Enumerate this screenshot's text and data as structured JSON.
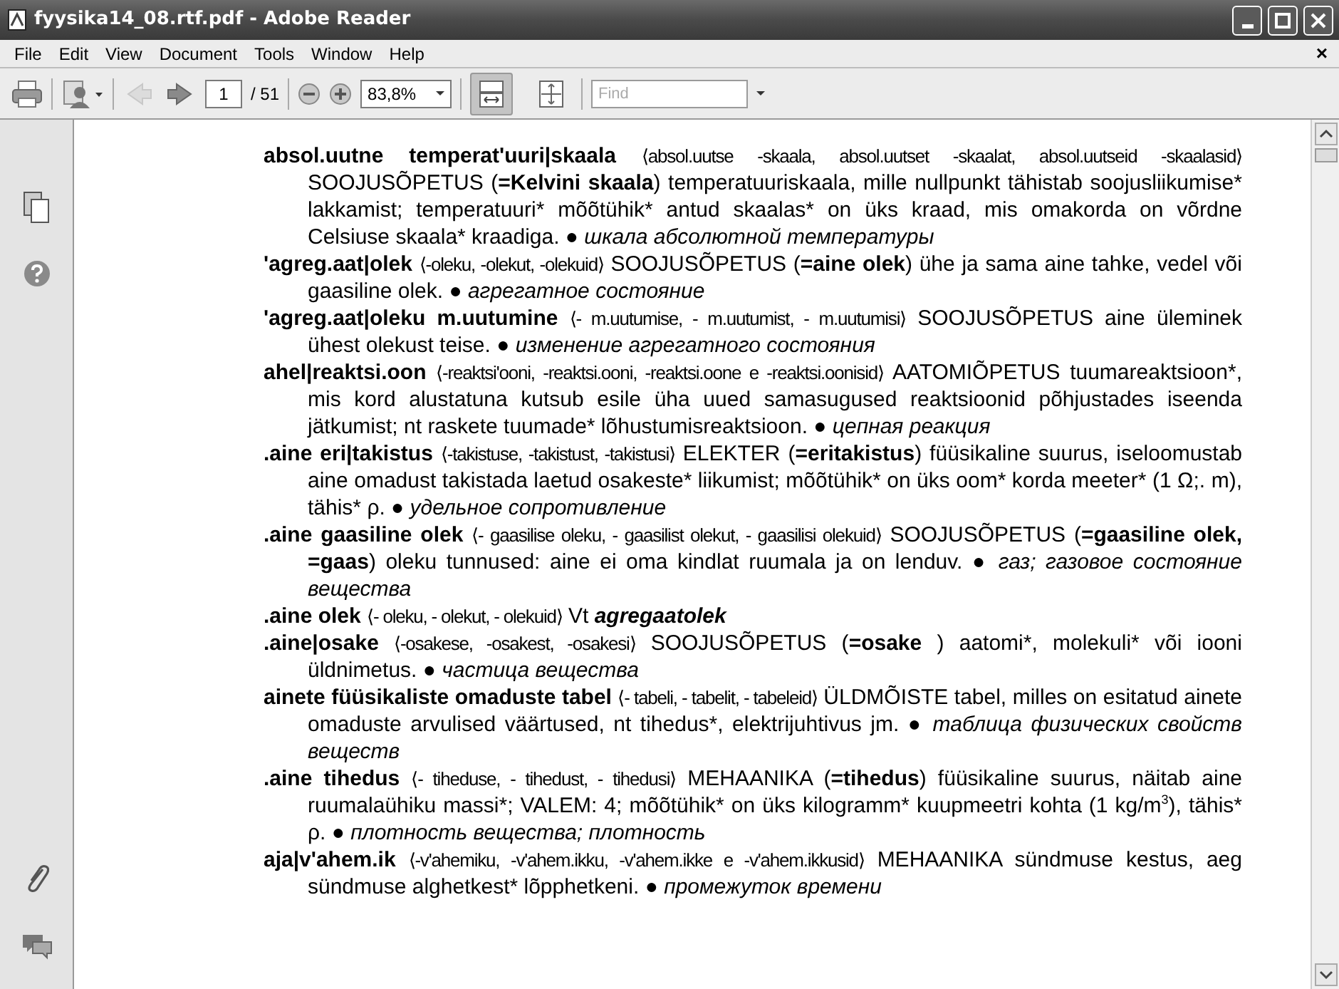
{
  "window": {
    "title": "fyysika14_08.rtf.pdf - Adobe Reader"
  },
  "menu": [
    "File",
    "Edit",
    "View",
    "Document",
    "Tools",
    "Window",
    "Help"
  ],
  "menu_close": "×",
  "toolbar": {
    "nav_buttons": [
      {
        "kind": "back",
        "disabled": true
      },
      {
        "kind": "forward",
        "disabled": false
      }
    ],
    "page_field": {
      "value": "1"
    },
    "page_count": "/ 51",
    "zoom_field": {
      "value": "83,8%"
    },
    "view_buttons": [
      {
        "kind": "fit-width",
        "selected": true
      },
      {
        "kind": "fit-page",
        "selected": false
      }
    ],
    "find_field": {
      "placeholder": "Find"
    }
  },
  "entries": [
    {
      "headword": "absol.uutne temperat'uuri|skaala",
      "forms": "⟨absol.uutse -skaala, absol.uutset -skaalat, absol.uutseid -skaalasid⟩",
      "body": [
        {
          "kind": "plain",
          "text": "SOOJUSÕPETUS ("
        },
        {
          "kind": "bold",
          "text": "=Kelvini skaala"
        },
        {
          "kind": "plain",
          "text": ") temperatuuriskaala, mille nullpunkt tähistab soojusliikumise* lakkamist; temperatuuri* mõõtühik* antud skaalas* on üks kraad, mis omakorda on võrdne Celsiuse skaala* kraadiga. ● "
        },
        {
          "kind": "italic",
          "text": "шкала абсолютной температуры"
        }
      ]
    },
    {
      "headword": "'agreg.aat|olek",
      "forms": "⟨-oleku, -olekut, -olekuid⟩",
      "body": [
        {
          "kind": "plain",
          "text": "SOOJUSÕPETUS ("
        },
        {
          "kind": "bold",
          "text": "=aine olek"
        },
        {
          "kind": "plain",
          "text": ") ühe ja sama aine tahke, vedel või gaasiline olek. ● "
        },
        {
          "kind": "italic",
          "text": "агрегатное состояние"
        }
      ]
    },
    {
      "headword": "'agreg.aat|oleku m.uutumine",
      "forms": "⟨- m.uutumise, - m.uutumist, - m.uutumisi⟩",
      "body": [
        {
          "kind": "plain",
          "text": "SOOJUSÕPETUS aine üleminek ühest olekust teise. ● "
        },
        {
          "kind": "italic",
          "text": "изменение агрегатного состояния"
        }
      ]
    },
    {
      "headword": "ahel|reaktsi.oon",
      "forms": "⟨-reaktsi'ooni, -reaktsi.ooni, -reaktsi.oone e -reaktsi.oonisid⟩",
      "body": [
        {
          "kind": "plain",
          "text": "AATOMIÕPETUS tuumareaktsioon*, mis kord alustatuna kutsub esile üha uued samasugused reaktsioonid põhjustades iseenda jätkumist; nt raskete tuumade* lõhustumisreaktsioon. ● "
        },
        {
          "kind": "italic",
          "text": "цепная реакция"
        }
      ]
    },
    {
      "headword": ".aine eri|takistus",
      "forms": "⟨-takistuse, -takistust, -takistusi⟩",
      "body": [
        {
          "kind": "plain",
          "text": "ELEKTER ("
        },
        {
          "kind": "bold",
          "text": "=eritakistus"
        },
        {
          "kind": "plain",
          "text": ") füüsikaline suurus, iseloomustab aine omadust takistada laetud osakeste* liikumist; mõõtühik* on üks oom* korda meeter* (1 Ω;. m), tähis* ρ. ● "
        },
        {
          "kind": "italic",
          "text": "удельное сопротивление"
        }
      ]
    },
    {
      "headword": ".aine gaasiline olek",
      "forms": "⟨- gaasilise oleku, - gaasilist olekut, - gaasilisi olekuid⟩",
      "body": [
        {
          "kind": "plain",
          "text": "SOOJUSÕPETUS ("
        },
        {
          "kind": "bold",
          "text": "=gaasiline olek, =gaas"
        },
        {
          "kind": "plain",
          "text": ") oleku tunnused: aine ei oma kindlat ruumala ja on lenduv. ● "
        },
        {
          "kind": "italic",
          "text": "газ; газовое состояние вещества"
        }
      ]
    },
    {
      "headword": ".aine olek",
      "forms": "⟨- oleku, - olekut, - olekuid⟩",
      "body": [
        {
          "kind": "plain",
          "text": "Vt "
        },
        {
          "kind": "bold-italic",
          "text": "agregaatolek"
        }
      ]
    },
    {
      "headword": ".aine|osake",
      "forms": "⟨-osakese, -osakest, -osakesi⟩",
      "body": [
        {
          "kind": "plain",
          "text": "SOOJUSÕPETUS ("
        },
        {
          "kind": "bold",
          "text": "=osake"
        },
        {
          "kind": "plain",
          "text": " ) aatomi*, molekuli* või iooni üldnimetus. ● "
        },
        {
          "kind": "italic",
          "text": "частица вещества"
        }
      ]
    },
    {
      "headword": "ainete füüsikaliste omaduste tabel",
      "forms": "⟨- tabeli, - tabelit, - tabeleid⟩",
      "body": [
        {
          "kind": "plain",
          "text": "ÜLDMÕISTE tabel, milles on esitatud ainete omaduste arvulised väärtused, nt tihedus*, elektrijuhtivus jm. ● "
        },
        {
          "kind": "italic",
          "text": "таблица физических свойств веществ"
        }
      ]
    },
    {
      "headword": ".aine tihedus",
      "forms": "⟨- tiheduse, - tihedust, - tihedusi⟩",
      "body": [
        {
          "kind": "plain",
          "text": "MEHAANIKA ("
        },
        {
          "kind": "bold",
          "text": "=tihedus"
        },
        {
          "kind": "plain",
          "text": ") füüsikaline suurus, näitab aine ruumalaühiku massi*; VALEM: 4; mõõtühik* on üks kilogramm* kuupmeetri kohta (1 kg/m"
        },
        {
          "kind": "sup",
          "text": "3"
        },
        {
          "kind": "plain",
          "text": "), tähis* ρ. ● "
        },
        {
          "kind": "italic",
          "text": "плотность вещества; плотность"
        }
      ]
    },
    {
      "headword": "aja|v'ahem.ik",
      "forms": "⟨-v'ahemiku, -v'ahem.ikku, -v'ahem.ikke e -v'ahem.ikkusid⟩",
      "body": [
        {
          "kind": "plain",
          "text": "MEHAANIKA sündmuse kestus, aeg sündmuse alghetkest* lõpphetkeni. ● "
        },
        {
          "kind": "italic",
          "text": "промежуток времени"
        }
      ]
    }
  ]
}
